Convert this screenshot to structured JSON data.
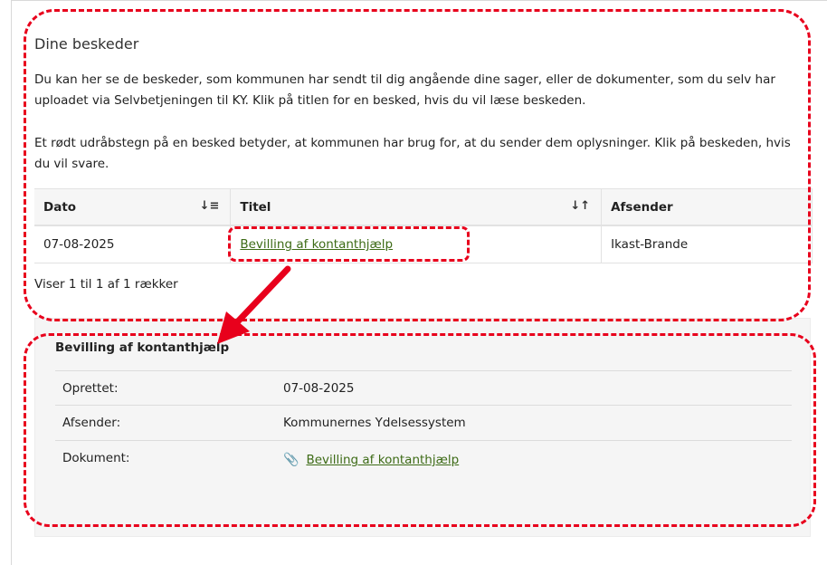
{
  "section": {
    "title": "Dine beskeder",
    "intro": "Du kan her se de beskeder, som kommunen har sendt til dig angående dine sager, eller de dokumenter, som du selv har uploadet via Selvbetjeningen til KY. Klik på titlen for en besked, hvis du vil læse beskeden.",
    "note": "Et rødt udråbstegn på en besked betyder, at kommunen har brug for, at du sender dem oplysninger. Klik på beskeden, hvis du vil svare."
  },
  "table": {
    "headers": {
      "date": "Dato",
      "title": "Titel",
      "sender": "Afsender"
    },
    "rows": [
      {
        "date": "07-08-2025",
        "title": "Bevilling af kontanthjælp",
        "sender": "Ikast-Brande"
      }
    ],
    "pager": "Viser 1 til 1 af 1 rækker"
  },
  "detail": {
    "title": "Bevilling af kontanthjælp",
    "created_label": "Oprettet:",
    "created_value": "07-08-2025",
    "sender_label": "Afsender:",
    "sender_value": "Kommunernes Ydelsessystem",
    "document_label": "Dokument:",
    "document_value": "Bevilling af kontanthjælp"
  },
  "icons": {
    "sort_date": "sort-descending-icon",
    "sort_title": "sort-icon",
    "attachment": "paperclip-icon"
  },
  "colors": {
    "link": "#3d6b16",
    "annotation": "#e8001c",
    "detail_bg": "#f5f5f5"
  }
}
